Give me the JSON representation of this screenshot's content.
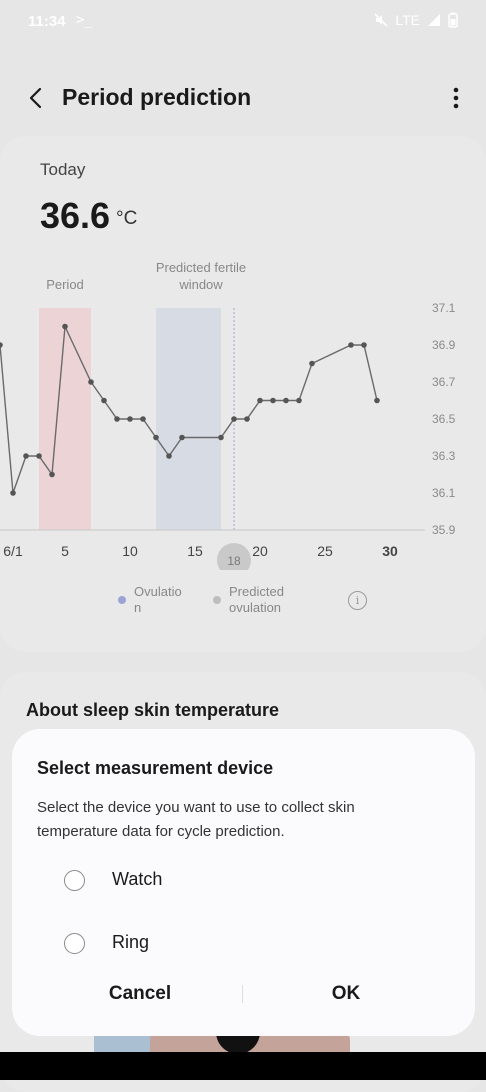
{
  "status": {
    "time": "11:34",
    "terminal": ">_",
    "network": "LTE"
  },
  "header": {
    "title": "Period prediction"
  },
  "today": {
    "label": "Today",
    "value": "36.6",
    "unit": "°C"
  },
  "chart_data": {
    "type": "line",
    "title": "",
    "bands": [
      {
        "label": "Period",
        "from": 4,
        "to": 8,
        "color": "#ebcfd2"
      },
      {
        "label": "Predicted fertile window",
        "from": 13,
        "to": 18,
        "color": "#d3d8e3"
      }
    ],
    "x": [
      2,
      3,
      4,
      5,
      6,
      8,
      9,
      10,
      11,
      12,
      13,
      14,
      15,
      18,
      19,
      20,
      21,
      22,
      23,
      24,
      25,
      28,
      29,
      30
    ],
    "y": [
      36.9,
      36.1,
      36.3,
      36.3,
      36.2,
      37.0,
      36.7,
      36.6,
      36.5,
      36.5,
      36.5,
      36.4,
      36.3,
      36.4,
      36.4,
      36.5,
      36.5,
      36.6,
      36.6,
      36.6,
      36.6,
      36.8,
      36.9,
      36.9,
      36.9,
      36.6
    ],
    "points": [
      [
        0,
        36.9
      ],
      [
        1,
        36.1
      ],
      [
        2,
        36.3
      ],
      [
        3,
        36.3
      ],
      [
        4,
        36.2
      ],
      [
        5,
        37.0
      ],
      [
        7,
        36.7
      ],
      [
        8,
        36.6
      ],
      [
        9,
        36.5
      ],
      [
        10,
        36.5
      ],
      [
        11,
        36.5
      ],
      [
        12,
        36.4
      ],
      [
        13,
        36.3
      ],
      [
        14,
        36.4
      ],
      [
        17,
        36.4
      ],
      [
        18,
        36.5
      ],
      [
        19,
        36.5
      ],
      [
        20,
        36.6
      ],
      [
        21,
        36.6
      ],
      [
        22,
        36.6
      ],
      [
        23,
        36.6
      ],
      [
        24,
        36.8
      ],
      [
        27,
        36.9
      ],
      [
        28,
        36.9
      ],
      [
        29,
        36.6
      ]
    ],
    "x_ticks": [
      "6/1",
      "5",
      "10",
      "15",
      "18",
      "20",
      "25",
      "30"
    ],
    "x_tick_days": [
      1,
      5,
      10,
      15,
      18,
      20,
      25,
      30
    ],
    "highlight_tick": "18",
    "bold_tick": "30",
    "y_ticks": [
      "37.1",
      "36.9",
      "36.7",
      "36.5",
      "36.3",
      "36.1",
      "35.9"
    ],
    "ylim": [
      35.9,
      37.1
    ],
    "xlim": [
      0,
      30
    ],
    "today_day": 18,
    "legend": [
      {
        "label": "Ovulation",
        "line1": "Ovulatio",
        "line2": "n",
        "color": "#9aa3d6"
      },
      {
        "label": "Predicted ovulation",
        "line1": "Predicted",
        "line2": "ovulation",
        "color": "#bdbdbd"
      }
    ]
  },
  "about": {
    "title": "About sleep skin temperature"
  },
  "dialog": {
    "title": "Select measurement device",
    "message": "Select the device you want to use to collect skin temperature data for cycle prediction.",
    "options": [
      {
        "label": "Watch"
      },
      {
        "label": "Ring"
      }
    ],
    "cancel": "Cancel",
    "ok": "OK"
  }
}
